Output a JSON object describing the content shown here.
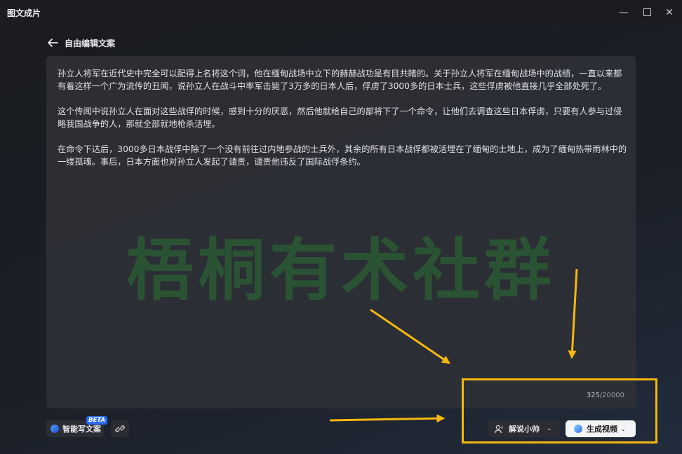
{
  "window": {
    "title": "图文成片",
    "minimize_icon": "minimize-icon",
    "maximize_icon": "maximize-icon",
    "close_icon": "close-icon"
  },
  "header": {
    "back_icon": "arrow-left-icon",
    "title": "自由编辑文案"
  },
  "editor": {
    "paragraphs": [
      "孙立人将军在近代史中完全可以配得上名将这个词，他在缅甸战场中立下的赫赫战功是有目共睹的。关于孙立人将军在缅甸战场中的战绩，一直以来都有着这样一个广为流传的丑闻，说孙立人在战斗中率军击毙了3万多的日本人后，俘虏了3000多的日本士兵，这些俘虏被他直接几乎全部处死了。",
      "这个传闻中说孙立人在面对这些战俘的时候，感到十分的厌恶，然后他就给自己的部将下了一个命令，让他们去调查这些日本俘虏，只要有人参与过侵略我国战争的人，那就全部就地枪杀活埋。",
      "在命令下达后，3000多日本战俘中除了一个没有前往过内地参战的士兵外，其余的所有日本战俘都被活埋在了缅甸的土地上，成为了缅甸热带雨林中的一缕孤魂。事后，日本方面也对孙立人发起了谴责，谴责他违反了国际战俘条约。"
    ],
    "watermark": "梧桐有术社群",
    "char_count": "325",
    "char_limit": "/20000"
  },
  "footer": {
    "ai_write_label": "智能写文案",
    "beta_badge": "BETA",
    "link_icon": "link-icon",
    "narrator_label": "解说小帅",
    "narrator_icon": "voice-person-icon",
    "generate_label": "生成视频",
    "generate_icon": "generate-video-icon"
  },
  "annotation": {
    "color": "#f5b70f"
  }
}
